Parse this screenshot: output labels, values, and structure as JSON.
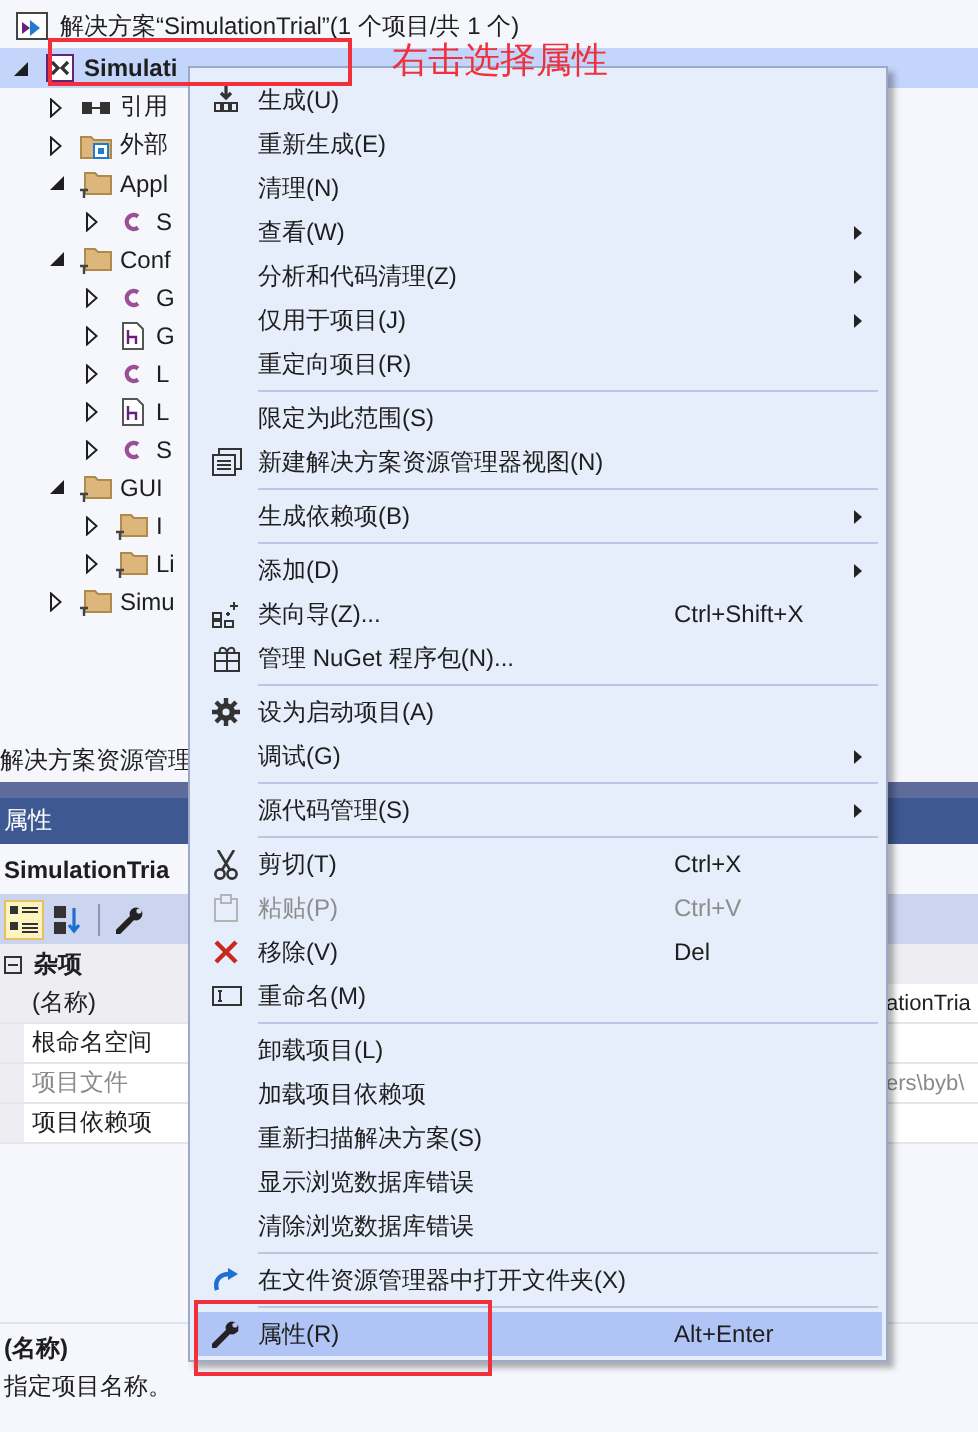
{
  "solution_title": "解决方案“SimulationTrial”(1 个项目/共 1 个)",
  "tree": [
    {
      "label": "Simulati",
      "kind": "project",
      "selected": true,
      "expanded": true,
      "children": [
        {
          "label": "引用",
          "kind": "references",
          "selected": false,
          "expanded": false
        },
        {
          "label": "外部",
          "kind": "external",
          "selected": false,
          "expanded": false
        },
        {
          "label": "Appl",
          "kind": "folder",
          "selected": false,
          "expanded": true,
          "children": [
            {
              "label": "S",
              "kind": "cs",
              "selected": false,
              "expanded": false
            }
          ]
        },
        {
          "label": "Conf",
          "kind": "folder",
          "selected": false,
          "expanded": true,
          "children": [
            {
              "label": "G",
              "kind": "cs",
              "selected": false,
              "expanded": false
            },
            {
              "label": "G",
              "kind": "header",
              "selected": false,
              "expanded": false
            },
            {
              "label": "L",
              "kind": "cs",
              "selected": false,
              "expanded": false
            },
            {
              "label": "L",
              "kind": "header",
              "selected": false,
              "expanded": false
            },
            {
              "label": "S",
              "kind": "cs",
              "selected": false,
              "expanded": false
            }
          ]
        },
        {
          "label": "GUI",
          "kind": "folder",
          "selected": false,
          "expanded": true,
          "children": [
            {
              "label": "I",
              "kind": "folder",
              "selected": false,
              "expanded": false
            },
            {
              "label": "Li",
              "kind": "folder",
              "selected": false,
              "expanded": false
            }
          ]
        },
        {
          "label": "Simu",
          "kind": "folder",
          "selected": false,
          "expanded": false
        }
      ]
    }
  ],
  "explorer_tab": "解决方案资源管理",
  "properties": {
    "title": "属性",
    "object": "SimulationTria",
    "toolbar": [
      {
        "kind": "categorized",
        "selected": true
      },
      {
        "kind": "alphabetical",
        "selected": false
      },
      {
        "kind": "property-pages",
        "selected": false
      }
    ],
    "category": "杂项",
    "rows": [
      {
        "name": "(名称)",
        "value": "ationTria",
        "selected": true,
        "disabled": false
      },
      {
        "name": "根命名空间",
        "selected": false,
        "disabled": false
      },
      {
        "name": "项目文件",
        "value": "ers\\byb\\",
        "selected": false,
        "disabled": true
      },
      {
        "name": "项目依赖项",
        "selected": false,
        "disabled": false
      }
    ],
    "description_title": "(名称)",
    "description": "指定项目名称。"
  },
  "context_menu": [
    {
      "kind": "item",
      "label": "生成(U)",
      "selected": false,
      "disabled": false
    },
    {
      "kind": "item",
      "label": "重新生成(E)",
      "selected": false,
      "disabled": false
    },
    {
      "kind": "item",
      "label": "清理(N)",
      "selected": false,
      "disabled": false
    },
    {
      "kind": "item",
      "label": "查看(W)",
      "submenu": true,
      "selected": false,
      "disabled": false
    },
    {
      "kind": "item",
      "label": "分析和代码清理(Z)",
      "submenu": true,
      "selected": false,
      "disabled": false
    },
    {
      "kind": "item",
      "label": "仅用于项目(J)",
      "submenu": true,
      "selected": false,
      "disabled": false
    },
    {
      "kind": "item",
      "label": "重定向项目(R)",
      "selected": false,
      "disabled": false
    },
    {
      "kind": "separator"
    },
    {
      "kind": "item",
      "label": "限定为此范围(S)",
      "selected": false,
      "disabled": false
    },
    {
      "kind": "item",
      "label": "新建解决方案资源管理器视图(N)",
      "selected": false,
      "disabled": false
    },
    {
      "kind": "separator"
    },
    {
      "kind": "item",
      "label": "生成依赖项(B)",
      "submenu": true,
      "selected": false,
      "disabled": false
    },
    {
      "kind": "separator"
    },
    {
      "kind": "item",
      "label": "添加(D)",
      "submenu": true,
      "selected": false,
      "disabled": false
    },
    {
      "kind": "item",
      "label": "类向导(Z)...",
      "shortcut": "Ctrl+Shift+X",
      "selected": false,
      "disabled": false
    },
    {
      "kind": "item",
      "label": "管理 NuGet 程序包(N)...",
      "selected": false,
      "disabled": false
    },
    {
      "kind": "separator"
    },
    {
      "kind": "item",
      "label": "设为启动项目(A)",
      "selected": false,
      "disabled": false
    },
    {
      "kind": "item",
      "label": "调试(G)",
      "submenu": true,
      "selected": false,
      "disabled": false
    },
    {
      "kind": "separator"
    },
    {
      "kind": "item",
      "label": "源代码管理(S)",
      "submenu": true,
      "selected": false,
      "disabled": false
    },
    {
      "kind": "separator"
    },
    {
      "kind": "item",
      "label": "剪切(T)",
      "shortcut": "Ctrl+X",
      "selected": false,
      "disabled": false
    },
    {
      "kind": "item",
      "label": "粘贴(P)",
      "shortcut": "Ctrl+V",
      "selected": false,
      "disabled": true
    },
    {
      "kind": "item",
      "label": "移除(V)",
      "shortcut": "Del",
      "selected": false,
      "disabled": false
    },
    {
      "kind": "item",
      "label": "重命名(M)",
      "selected": false,
      "disabled": false
    },
    {
      "kind": "separator"
    },
    {
      "kind": "item",
      "label": "卸载项目(L)",
      "selected": false,
      "disabled": false
    },
    {
      "kind": "item",
      "label": "加载项目依赖项",
      "selected": false,
      "disabled": false
    },
    {
      "kind": "item",
      "label": "重新扫描解决方案(S)",
      "selected": false,
      "disabled": false
    },
    {
      "kind": "item",
      "label": "显示浏览数据库错误",
      "selected": false,
      "disabled": false
    },
    {
      "kind": "item",
      "label": "清除浏览数据库错误",
      "selected": false,
      "disabled": false
    },
    {
      "kind": "separator"
    },
    {
      "kind": "item",
      "label": "在文件资源管理器中打开文件夹(X)",
      "selected": false,
      "disabled": false
    },
    {
      "kind": "separator"
    },
    {
      "kind": "item",
      "label": "属性(R)",
      "shortcut": "Alt+Enter",
      "selected": true,
      "disabled": false
    }
  ],
  "annotation": "右击选择属性"
}
